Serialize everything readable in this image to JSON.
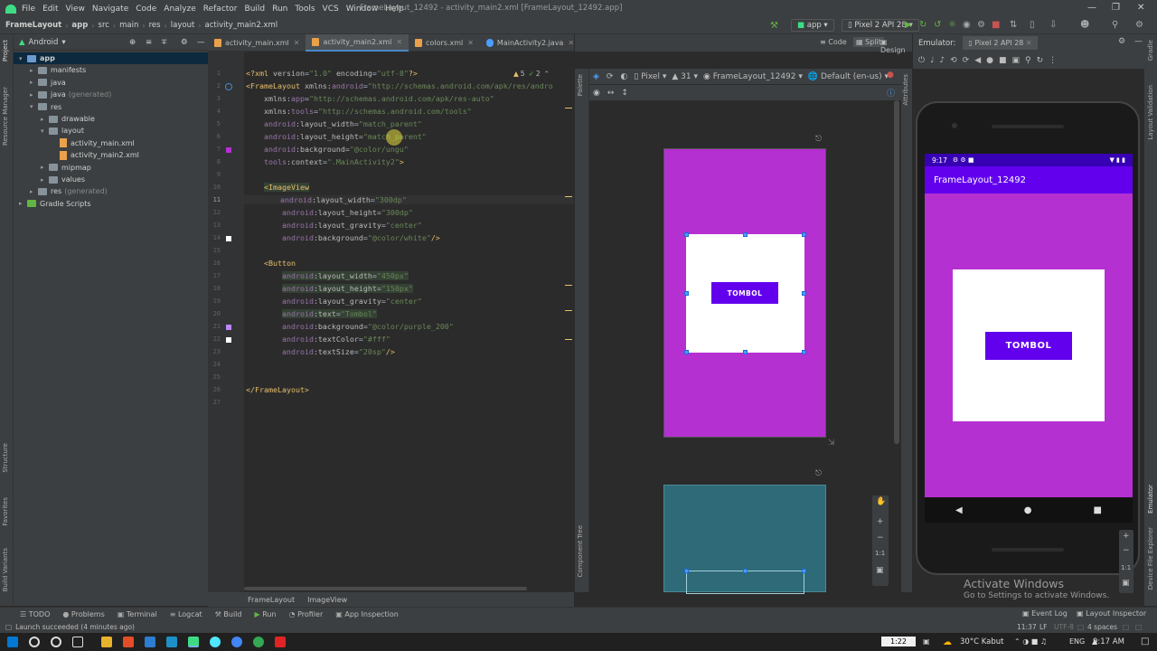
{
  "menu": [
    "File",
    "Edit",
    "View",
    "Navigate",
    "Code",
    "Analyze",
    "Refactor",
    "Build",
    "Run",
    "Tools",
    "VCS",
    "Window",
    "Help"
  ],
  "window_title": "FrameLayout_12492 - activity_main2.xml [FrameLayout_12492.app]",
  "breadcrumb": [
    "FrameLayout",
    "app",
    "src",
    "main",
    "res",
    "layout",
    "activity_main2.xml"
  ],
  "run_config": "app",
  "device_combo": "Pixel 2 API 28",
  "project_view": "Android",
  "tree": [
    {
      "label": "app",
      "indent": 0,
      "kind": "module",
      "open": true,
      "sel": true
    },
    {
      "label": "manifests",
      "indent": 1,
      "kind": "folder"
    },
    {
      "label": "java",
      "indent": 1,
      "kind": "folder"
    },
    {
      "label": "java",
      "suffix": "(generated)",
      "indent": 1,
      "kind": "folder"
    },
    {
      "label": "res",
      "indent": 1,
      "kind": "folder",
      "open": true
    },
    {
      "label": "drawable",
      "indent": 2,
      "kind": "folder"
    },
    {
      "label": "layout",
      "indent": 2,
      "kind": "folder",
      "open": true
    },
    {
      "label": "activity_main.xml",
      "indent": 3,
      "kind": "file"
    },
    {
      "label": "activity_main2.xml",
      "indent": 3,
      "kind": "file"
    },
    {
      "label": "mipmap",
      "indent": 2,
      "kind": "folder"
    },
    {
      "label": "values",
      "indent": 2,
      "kind": "folder"
    },
    {
      "label": "res",
      "suffix": "(generated)",
      "indent": 1,
      "kind": "folder"
    },
    {
      "label": "Gradle Scripts",
      "indent": 0,
      "kind": "gradle"
    }
  ],
  "tabs": [
    {
      "label": "activity_main.xml",
      "active": false
    },
    {
      "label": "activity_main2.xml",
      "active": true
    },
    {
      "label": "colors.xml",
      "active": false
    },
    {
      "label": "MainActivity2.java",
      "active": false
    },
    {
      "label": "MainActivity.java",
      "active": false
    }
  ],
  "inspections": {
    "warnings": "5",
    "checks": "2"
  },
  "view_modes": [
    "Code",
    "Split",
    "Design"
  ],
  "design_toolbar": {
    "device": "Pixel",
    "api": "31",
    "theme_label": "FrameLayout_12492",
    "locale": "Default (en-us)"
  },
  "emulator": {
    "label": "Emulator:",
    "device_tab": "Pixel 2 API 28"
  },
  "phone": {
    "time": "9:17",
    "app_title": "FrameLayout_12492",
    "button": "TOMBOL"
  },
  "preview_button": "TOMBOL",
  "zoom_ratio": "1:1",
  "bottom_tabs": [
    "FrameLayout",
    "ImageView"
  ],
  "tool_windows": [
    "TODO",
    "Problems",
    "Terminal",
    "Logcat",
    "Build",
    "Run",
    "Profiler",
    "App Inspection"
  ],
  "tool_windows_right": [
    "Event Log",
    "Layout Inspector"
  ],
  "status": {
    "message": "Launch succeeded (4 minutes ago)",
    "position": "11:37",
    "line_sep": "LF",
    "encoding": "UTF-8",
    "indent": "4 spaces"
  },
  "watermark": {
    "title": "Activate Windows",
    "subtitle": "Go to Settings to activate Windows."
  },
  "left_tool_labels": [
    "Project",
    "Resource Manager",
    "Structure",
    "Favorites",
    "Build Variants"
  ],
  "right_tool_labels": [
    "Gradle",
    "Layout Validation",
    "Emulator",
    "Device File Explorer"
  ],
  "side_labels": {
    "palette": "Palette",
    "component_tree": "Component Tree",
    "attributes": "Attributes"
  },
  "taskbar": {
    "time_box": "1:22",
    "weather": "30°C Kabut",
    "lang": "ENG",
    "clock": "9:17 AM"
  },
  "colors": {
    "purple_bg": "#b530d1",
    "button": "#6200ee",
    "appbar": "#6200ee",
    "status": "#3700b3",
    "blueprint": "#2e6a77"
  }
}
